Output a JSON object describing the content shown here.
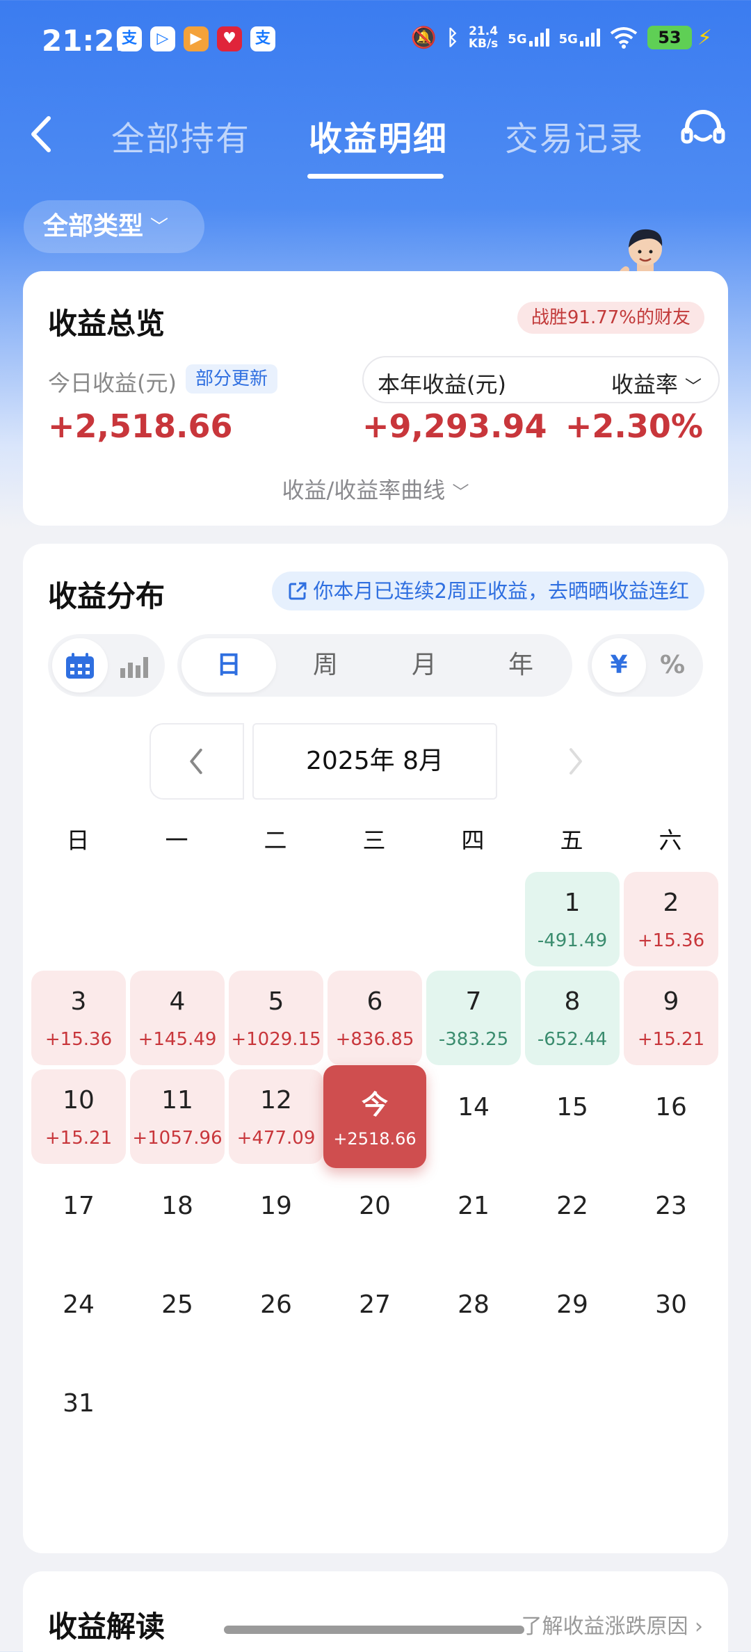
{
  "status_bar": {
    "time": "21:21",
    "apps": [
      {
        "label": "支",
        "color": "#1677ff"
      },
      {
        "label": "▷",
        "color": "#1677ff"
      },
      {
        "label": "▶",
        "color": "#f4a23a"
      },
      {
        "label": "♥",
        "color": "#e0243a"
      },
      {
        "label": "支",
        "color": "#1677ff"
      }
    ],
    "net_speed_value": "21.4",
    "net_speed_unit": "KB/s",
    "sig1": "5G",
    "sig2": "5G",
    "battery": "53"
  },
  "nav": {
    "tabs": [
      "全部持有",
      "收益明细",
      "交易记录"
    ],
    "active_tab": 1
  },
  "filter": {
    "type_label": "全部类型"
  },
  "overview": {
    "title": "收益总览",
    "beat_badge": "战胜91.77%的财友",
    "today_label": "今日收益(元)",
    "partial_badge": "部分更新",
    "today_value": "+2,518.66",
    "year_label": "本年收益(元)",
    "rate_label": "收益率",
    "year_value": "+9,293.94",
    "rate_value": "+2.30%",
    "curve_link": "收益/收益率曲线"
  },
  "distribution": {
    "title": "收益分布",
    "streak_text": "你本月已连续2周正收益，去晒晒收益连红",
    "period_tabs": [
      "日",
      "周",
      "月",
      "年"
    ],
    "active_period": 0,
    "unit_tabs": [
      "¥",
      "%"
    ],
    "active_unit": 0,
    "month_label": "2025年 8月",
    "weekdays": [
      "日",
      "一",
      "二",
      "三",
      "四",
      "五",
      "六"
    ]
  },
  "calendar": {
    "first_weekday": 5,
    "days": [
      {
        "n": "1",
        "v": "-491.49",
        "t": "loss"
      },
      {
        "n": "2",
        "v": "+15.36",
        "t": "gain"
      },
      {
        "n": "3",
        "v": "+15.36",
        "t": "gain"
      },
      {
        "n": "4",
        "v": "+145.49",
        "t": "gain"
      },
      {
        "n": "5",
        "v": "+1029.15",
        "t": "gain"
      },
      {
        "n": "6",
        "v": "+836.85",
        "t": "gain"
      },
      {
        "n": "7",
        "v": "-383.25",
        "t": "loss"
      },
      {
        "n": "8",
        "v": "-652.44",
        "t": "loss"
      },
      {
        "n": "9",
        "v": "+15.21",
        "t": "gain"
      },
      {
        "n": "10",
        "v": "+15.21",
        "t": "gain"
      },
      {
        "n": "11",
        "v": "+1057.96",
        "t": "gain"
      },
      {
        "n": "12",
        "v": "+477.09",
        "t": "gain"
      },
      {
        "n": "今",
        "v": "+2518.66",
        "t": "today"
      },
      {
        "n": "14",
        "v": "",
        "t": "plain"
      },
      {
        "n": "15",
        "v": "",
        "t": "plain"
      },
      {
        "n": "16",
        "v": "",
        "t": "plain"
      },
      {
        "n": "17",
        "v": "",
        "t": "plain"
      },
      {
        "n": "18",
        "v": "",
        "t": "plain"
      },
      {
        "n": "19",
        "v": "",
        "t": "plain"
      },
      {
        "n": "20",
        "v": "",
        "t": "plain"
      },
      {
        "n": "21",
        "v": "",
        "t": "plain"
      },
      {
        "n": "22",
        "v": "",
        "t": "plain"
      },
      {
        "n": "23",
        "v": "",
        "t": "plain"
      },
      {
        "n": "24",
        "v": "",
        "t": "plain"
      },
      {
        "n": "25",
        "v": "",
        "t": "plain"
      },
      {
        "n": "26",
        "v": "",
        "t": "plain"
      },
      {
        "n": "27",
        "v": "",
        "t": "plain"
      },
      {
        "n": "28",
        "v": "",
        "t": "plain"
      },
      {
        "n": "29",
        "v": "",
        "t": "plain"
      },
      {
        "n": "30",
        "v": "",
        "t": "plain"
      },
      {
        "n": "31",
        "v": "",
        "t": "plain"
      }
    ]
  },
  "interpretation": {
    "title": "收益解读",
    "link": "了解收益涨跌原因 ›"
  }
}
